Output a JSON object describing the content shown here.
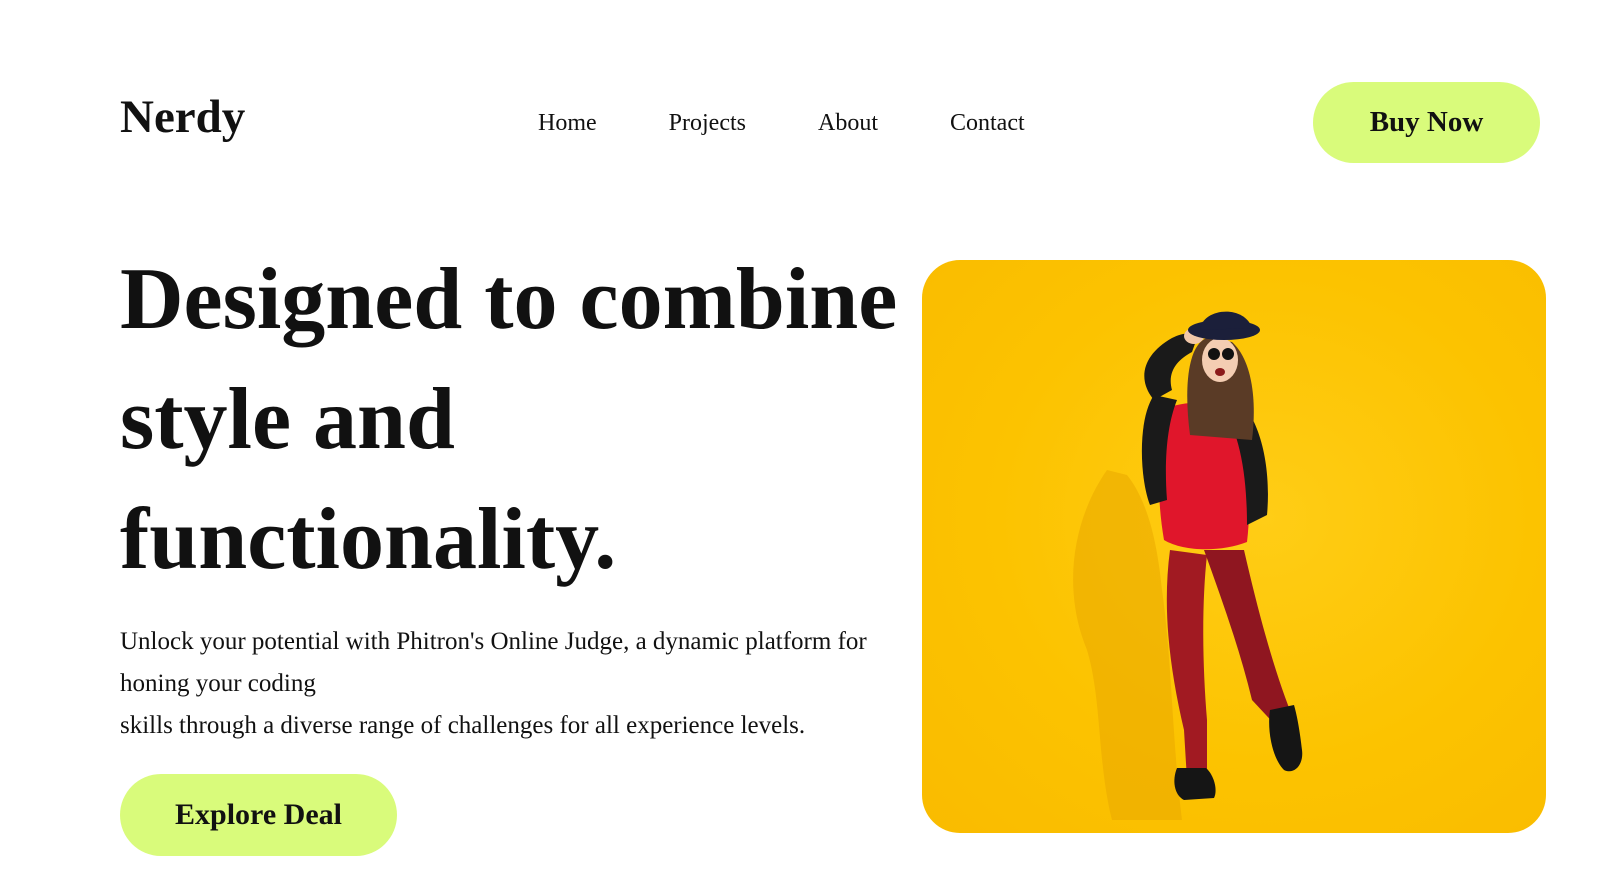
{
  "header": {
    "logo": "Nerdy",
    "nav": [
      {
        "label": "Home"
      },
      {
        "label": "Projects"
      },
      {
        "label": "About"
      },
      {
        "label": "Contact"
      }
    ],
    "cta_label": "Buy Now"
  },
  "hero": {
    "title": "Designed to combine style and functionality.",
    "description_lines": [
      "Unlock your potential with Phitron's Online Judge, a dynamic platform for honing your coding",
      "skills through a diverse range of challenges for all experience levels."
    ],
    "cta_label": "Explore Deal",
    "image": {
      "icon": "fashion-woman-photo",
      "background_color": "#fcc300"
    }
  },
  "colors": {
    "accent": "#d9fb7b",
    "text": "#111111",
    "image_bg": "#fcc300"
  }
}
